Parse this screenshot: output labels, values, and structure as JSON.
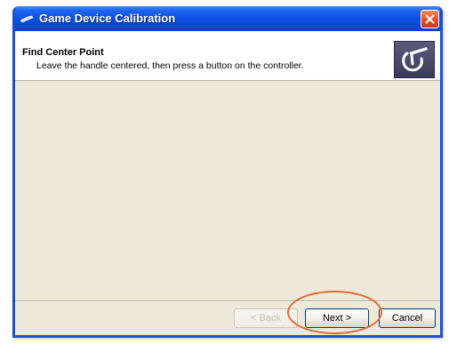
{
  "window": {
    "title": "Game Device Calibration"
  },
  "header": {
    "title": "Find Center Point",
    "subtitle": "Leave the handle centered, then press a button on the controller.",
    "icon": "joystick-icon"
  },
  "buttons": {
    "back_label": "< Back",
    "back_enabled": false,
    "next_label": "Next >",
    "cancel_label": "Cancel"
  },
  "colors": {
    "titlebar": "#0a4ee0",
    "window_bg": "#ece9d8",
    "highlight": "#e06a2a"
  }
}
